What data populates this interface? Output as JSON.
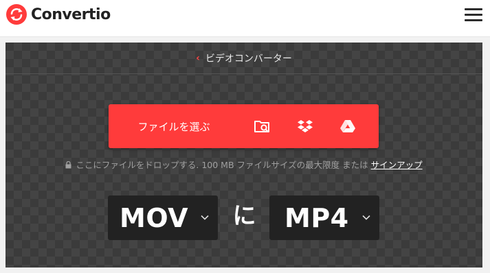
{
  "header": {
    "brand": "Convertio",
    "brand_color": "#ff3b3b"
  },
  "breadcrumb": {
    "label": "ビデオコンバーター"
  },
  "upload": {
    "choose_label": "ファイルを選ぶ",
    "sources": [
      "folder-search-icon",
      "dropbox-icon",
      "google-drive-icon"
    ]
  },
  "hint": {
    "text": "ここにファイルをドロップする. 100 MB ファイルサイズの最大限度 または ",
    "link": "サインアップ"
  },
  "conversion": {
    "from": "MOV",
    "connector": "に",
    "to": "MP4"
  }
}
